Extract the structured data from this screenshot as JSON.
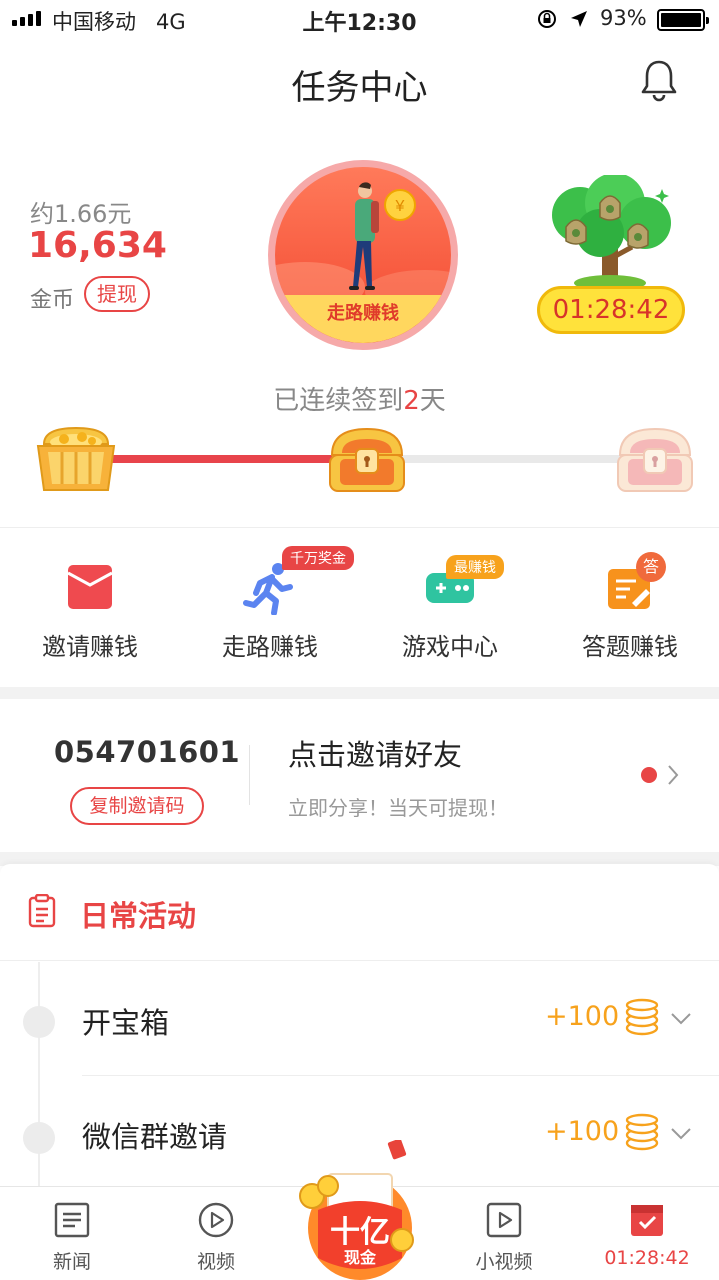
{
  "status_bar": {
    "carrier": "中国移动",
    "network": "4G",
    "time": "上午12:30",
    "battery": "93%"
  },
  "header": {
    "title": "任务中心"
  },
  "wallet": {
    "approx": "约1.66元",
    "coins": "16,634",
    "coins_label": "金币",
    "withdraw": "提现"
  },
  "walk_promo": {
    "label": "走路赚钱"
  },
  "money_tree": {
    "timer": "01:28:42"
  },
  "signin": {
    "prefix": "已连续签到",
    "days": "2",
    "suffix": "天"
  },
  "quick_actions": [
    {
      "label": "邀请赚钱",
      "badge": ""
    },
    {
      "label": "走路赚钱",
      "badge": "千万奖金"
    },
    {
      "label": "游戏中心",
      "badge": "最赚钱"
    },
    {
      "label": "答题赚钱",
      "badge": "答"
    }
  ],
  "invite": {
    "code": "054701601",
    "copy_button": "复制邀请码",
    "title": "点击邀请好友",
    "subtitle": "立即分享！当天可提现！"
  },
  "daily": {
    "title": "日常活动",
    "tasks": [
      {
        "name": "开宝箱",
        "reward": "+100"
      },
      {
        "name": "微信群邀请",
        "reward": "+100"
      }
    ]
  },
  "tabbar": {
    "items": [
      {
        "label": "新闻",
        "icon": "news-icon"
      },
      {
        "label": "视频",
        "icon": "video-icon"
      },
      {
        "label": "小视频",
        "icon": "short-video-icon"
      },
      {
        "label": "01:28:42",
        "icon": "task-icon"
      }
    ],
    "center": {
      "big": "十亿",
      "small": "现金"
    }
  },
  "colors": {
    "accent": "#e84545",
    "gold": "#f7a21c"
  }
}
